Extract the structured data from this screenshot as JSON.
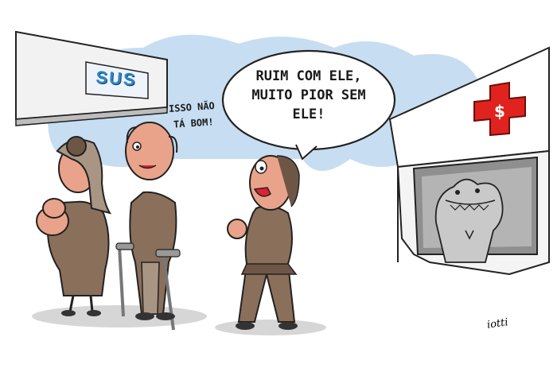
{
  "cartoon": {
    "sign_text": "SUS",
    "complaint_line1": "ISSO NÃO",
    "complaint_line2": "TÁ BOM!",
    "speech_line1": "RUIM COM ELE,",
    "speech_line2": "MUITO PIOR SEM",
    "speech_line3": "ELE!",
    "signature": "iotti",
    "clinic_symbol": "$"
  },
  "colors": {
    "sky": "#c7ddf1",
    "sus_blue": "#2e86c8",
    "clothing": "#8a6f5a",
    "clothing_dark": "#6e5646",
    "skin": "#e9a38a",
    "red_cross": "#e0231e"
  }
}
